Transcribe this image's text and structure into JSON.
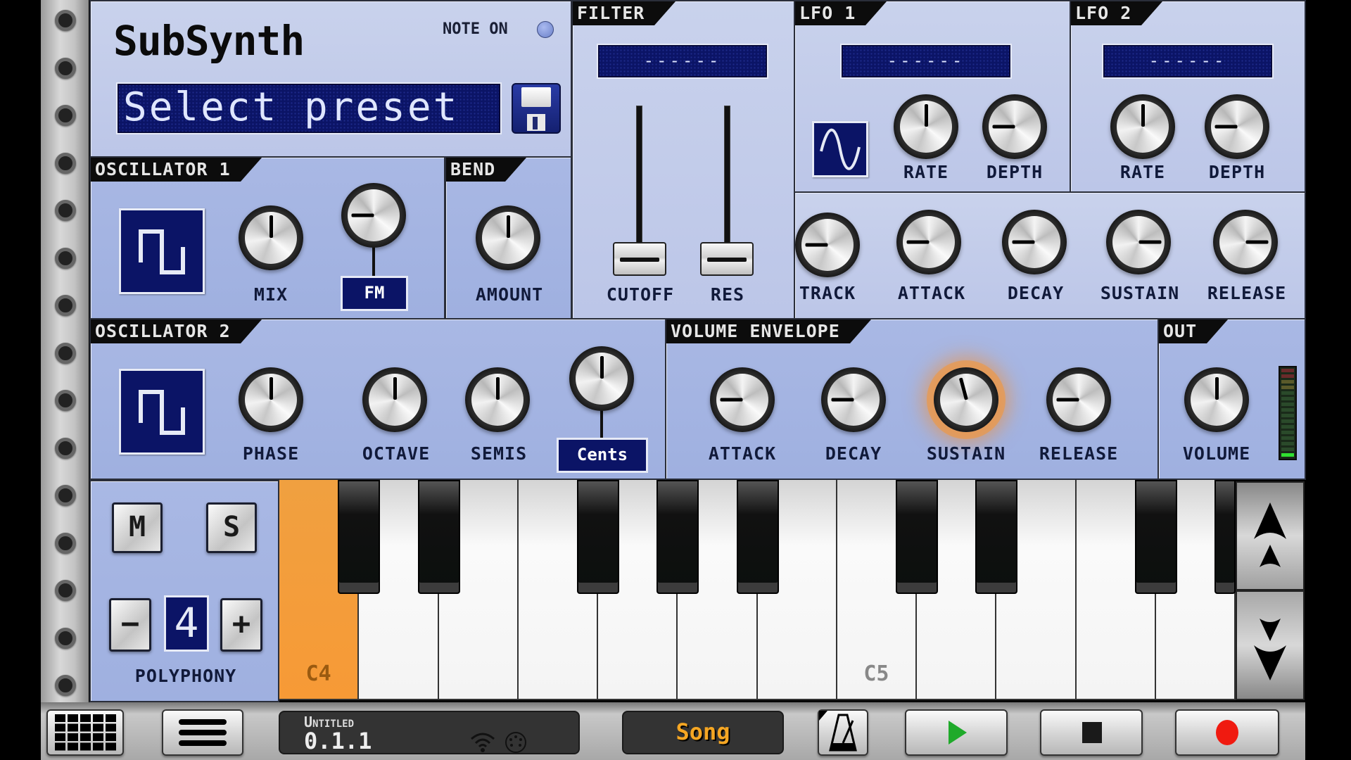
{
  "app": {
    "title": "SubSynth"
  },
  "header": {
    "note_on_label": "NOTE ON",
    "note_on_led_color": "#7e93d6",
    "preset_display": "Select preset",
    "save_icon": "floppy-disk-icon"
  },
  "filter": {
    "title": "FILTER",
    "display": "------",
    "sliders": [
      {
        "label": "CUTOFF",
        "value": 0
      },
      {
        "label": "RES",
        "value": 0
      }
    ]
  },
  "lfo1": {
    "title": "LFO 1",
    "display": "------",
    "waveform": "sine",
    "knobs": [
      {
        "label": "RATE",
        "value": 0.5
      },
      {
        "label": "DEPTH",
        "value": 0.2
      }
    ]
  },
  "lfo2": {
    "title": "LFO 2",
    "display": "------",
    "knobs": [
      {
        "label": "RATE",
        "value": 0.5
      },
      {
        "label": "DEPTH",
        "value": 0.2
      }
    ]
  },
  "filter_envelope": {
    "knobs": [
      {
        "label": "TRACK",
        "value": 0.2
      },
      {
        "label": "ATTACK",
        "value": 0.2
      },
      {
        "label": "DECAY",
        "value": 0.2
      },
      {
        "label": "SUSTAIN",
        "value": 0.8
      },
      {
        "label": "RELEASE",
        "value": 0.8
      }
    ]
  },
  "oscillator1": {
    "title": "OSCILLATOR 1",
    "waveform": "square",
    "knobs": [
      {
        "label": "MIX",
        "value": 0.5
      },
      {
        "label": "FM",
        "value": 0.2,
        "selected": true
      }
    ]
  },
  "bend": {
    "title": "BEND",
    "knobs": [
      {
        "label": "AMOUNT",
        "value": 0.5
      }
    ]
  },
  "oscillator2": {
    "title": "OSCILLATOR 2",
    "waveform": "square",
    "knobs": [
      {
        "label": "PHASE",
        "value": 0.5
      },
      {
        "label": "OCTAVE",
        "value": 0.5
      },
      {
        "label": "SEMIS",
        "value": 0.5
      },
      {
        "label": "Cents",
        "value": 0.5,
        "selected": true
      }
    ]
  },
  "volume_envelope": {
    "title": "VOLUME ENVELOPE",
    "knobs": [
      {
        "label": "ATTACK",
        "value": 0.2
      },
      {
        "label": "DECAY",
        "value": 0.2
      },
      {
        "label": "SUSTAIN",
        "value": 0.45,
        "active": true
      },
      {
        "label": "RELEASE",
        "value": 0.2
      }
    ]
  },
  "out": {
    "title": "OUT",
    "knobs": [
      {
        "label": "VOLUME",
        "value": 0.5
      }
    ],
    "meter_level": 0.06
  },
  "polyphony": {
    "mute_label": "M",
    "solo_label": "S",
    "minus_label": "−",
    "plus_label": "+",
    "value": "4",
    "label": "POLYPHONY"
  },
  "keyboard": {
    "white_keys": [
      "C4",
      "D4",
      "E4",
      "F4",
      "G4",
      "A4",
      "B4",
      "C5",
      "D5",
      "E5",
      "F5",
      "G5"
    ],
    "pressed": [
      "C4"
    ],
    "labels": {
      "C4": "C4",
      "C5": "C5"
    },
    "octave_up_icon": "double-chevron-up-icon",
    "octave_down_icon": "double-chevron-down-icon"
  },
  "transport": {
    "song_name": "Untitled",
    "position": "0.1.1",
    "mode_label": "Song",
    "mode_color": "#f5a623",
    "play_color": "#1faa2a",
    "record_color": "#f01a10"
  }
}
